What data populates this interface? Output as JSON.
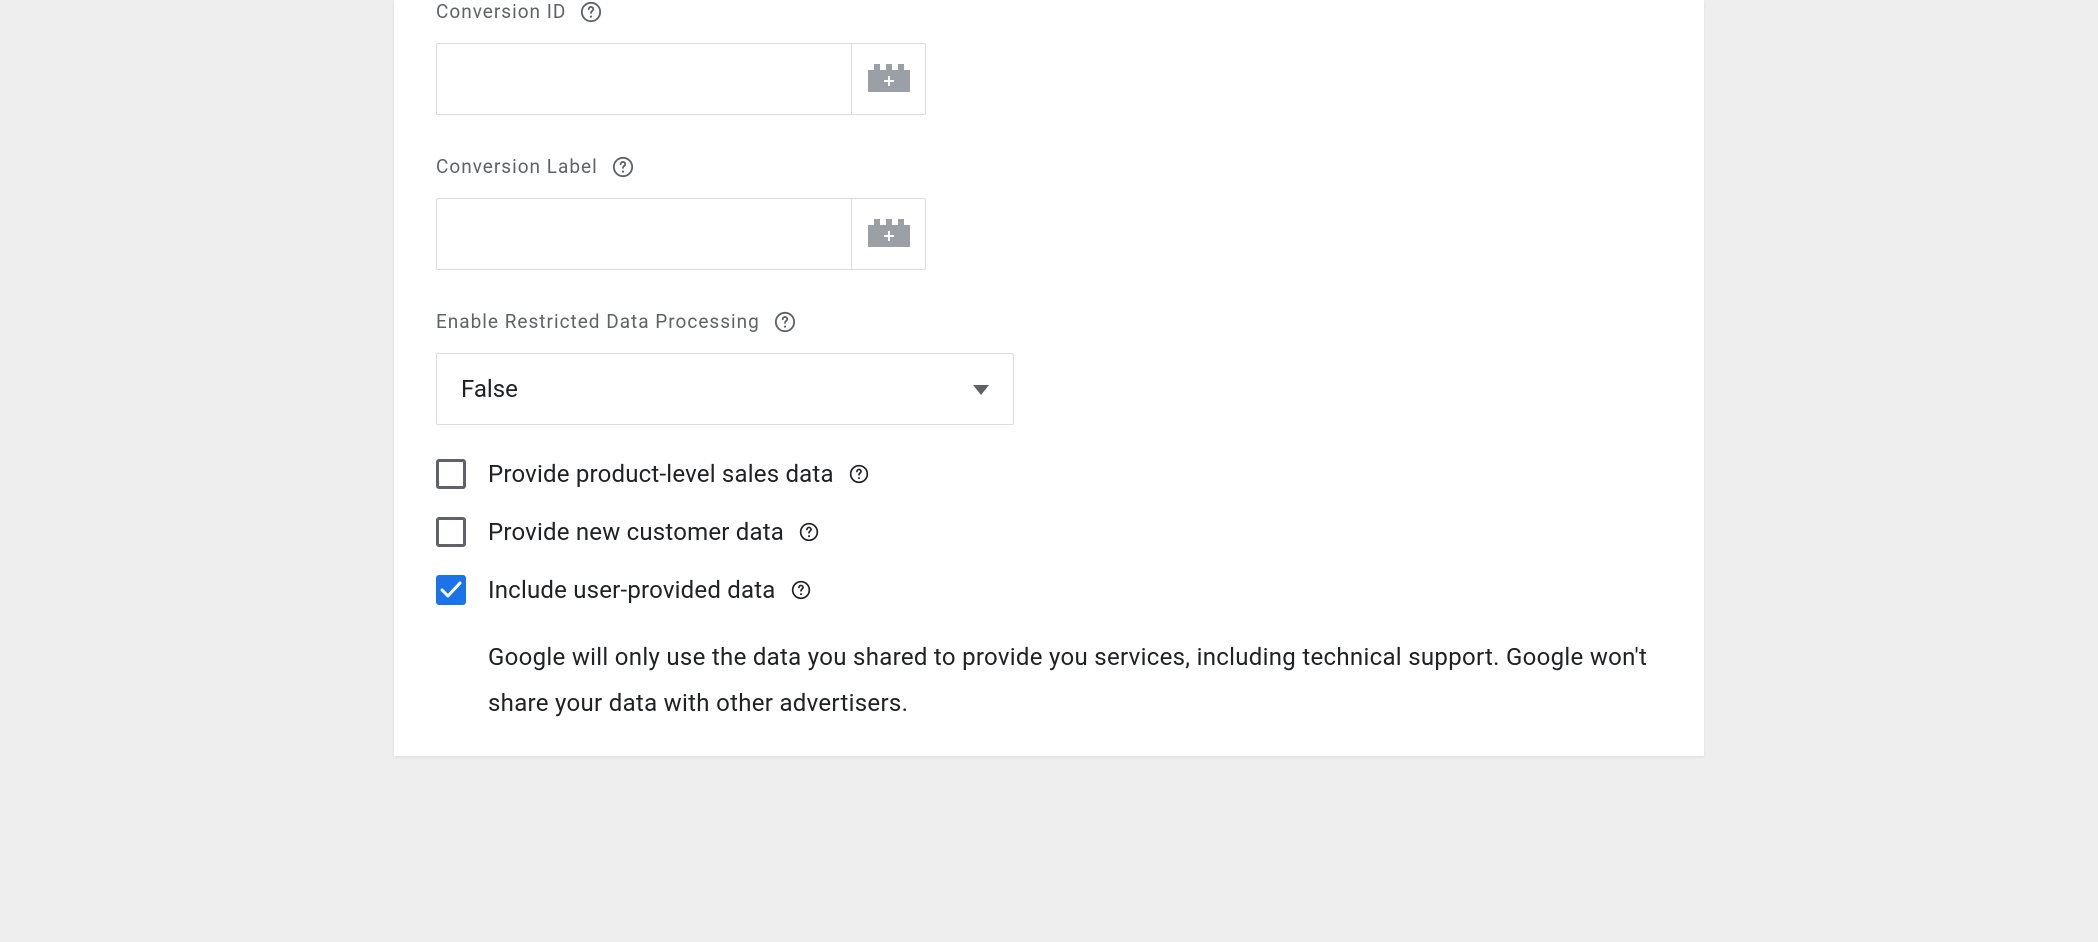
{
  "fields": {
    "conversion_id": {
      "label": "Conversion ID",
      "value": ""
    },
    "conversion_label": {
      "label": "Conversion Label",
      "value": ""
    },
    "restricted_data": {
      "label": "Enable Restricted Data Processing",
      "selected": "False"
    }
  },
  "checkboxes": {
    "product_sales": {
      "label": "Provide product-level sales data",
      "checked": false
    },
    "new_customer": {
      "label": "Provide new customer data",
      "checked": false
    },
    "user_provided": {
      "label": "Include user-provided data",
      "checked": true,
      "description": "Google will only use the data you shared to provide you services, including technical support. Google won't share your data with other advertisers."
    }
  }
}
